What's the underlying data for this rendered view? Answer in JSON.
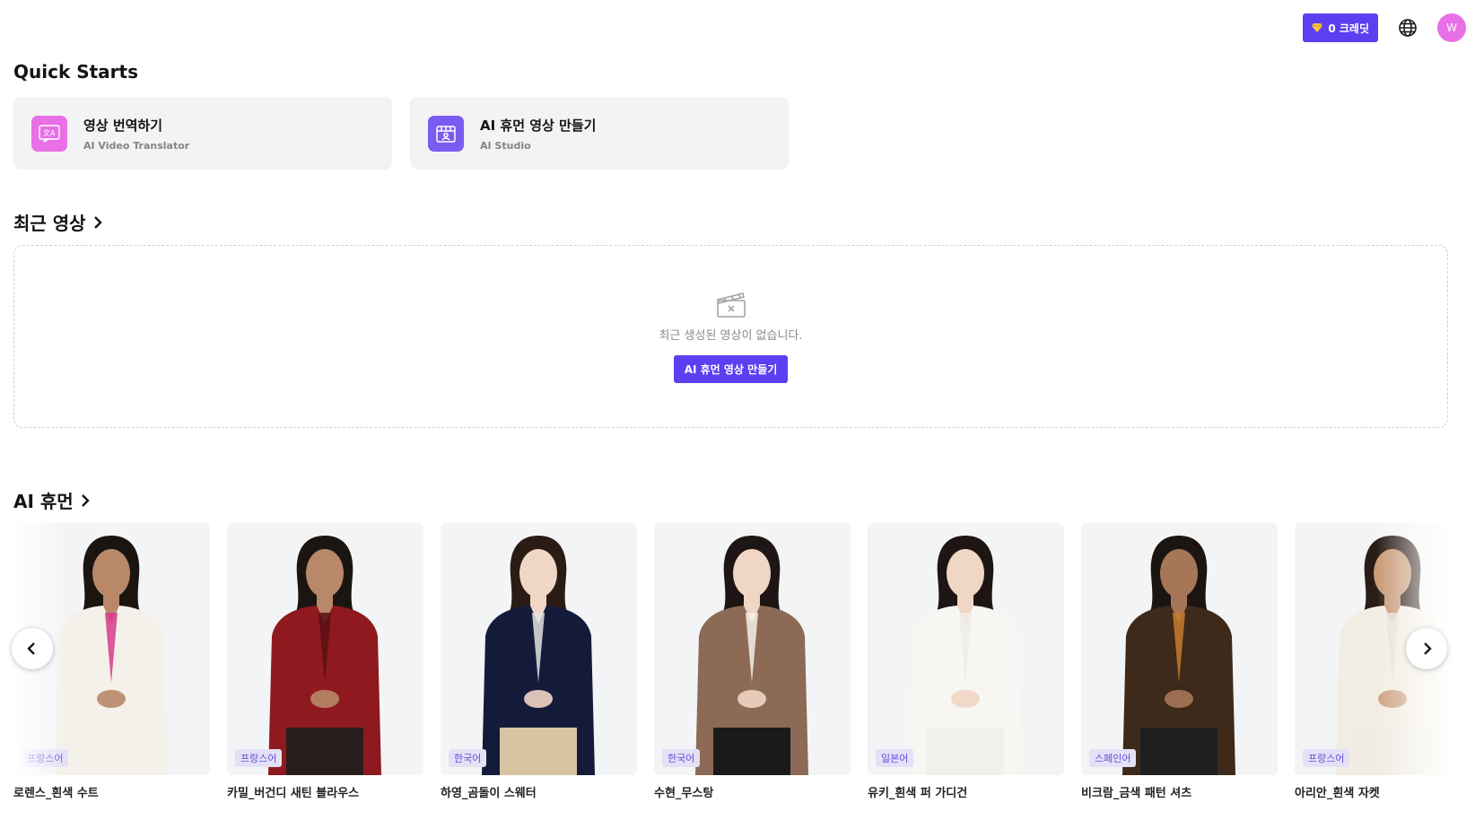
{
  "topbar": {
    "credit_label": "0 크레딧",
    "credit_icon": "gem-icon",
    "language_icon": "globe-icon",
    "avatar_initial": "W",
    "accent_color": "#5b3ff0",
    "avatar_color": "#e86fe6"
  },
  "quick_starts": {
    "title": "Quick Starts",
    "cards": [
      {
        "title": "영상 번역하기",
        "subtitle": "AI Video Translator",
        "icon": "translate-icon",
        "icon_color": "#e86fe6"
      },
      {
        "title": "AI 휴먼 영상 만들기",
        "subtitle": "AI Studio",
        "icon": "studio-icon",
        "icon_color": "#7b5cf0"
      }
    ]
  },
  "recent_videos": {
    "title": "최근 영상",
    "empty_icon": "clapperboard-icon",
    "empty_text": "최근 생성된 영상이 없습니다.",
    "cta_label": "AI 휴먼 영상 만들기"
  },
  "ai_humans": {
    "title": "AI 휴먼",
    "items": [
      {
        "name": "로렌스_흰색 수트",
        "language": "프랑스어",
        "hair": "#1b1512",
        "skin": "#b88868",
        "top": "#f4f1ea",
        "accent": "#d63c8a",
        "bottom": "#f4f1ea"
      },
      {
        "name": "카밀_버건디 새틴 블라우스",
        "language": "프랑스어",
        "hair": "#1b1512",
        "skin": "#b88868",
        "top": "#8e1a1f",
        "accent": "#5a0f12",
        "bottom": "#2a1e1c"
      },
      {
        "name": "하영_곰돌이 스웨터",
        "language": "한국어",
        "hair": "#2a1b14",
        "skin": "#f0d6c4",
        "top": "#141b3a",
        "accent": "#e3e3e3",
        "bottom": "#d8c3a3"
      },
      {
        "name": "수현_무스탕",
        "language": "한국어",
        "hair": "#1e1614",
        "skin": "#f0d6c4",
        "top": "#8c6a55",
        "accent": "#f4efe9",
        "bottom": "#1a1a1a"
      },
      {
        "name": "유키_흰색 퍼 가디건",
        "language": "일본어",
        "hair": "#1e1614",
        "skin": "#f0d6c4",
        "top": "#f7f6f3",
        "accent": "#efece6",
        "bottom": "#f2f0ec"
      },
      {
        "name": "비크람_금색 패턴 셔츠",
        "language": "스페인어",
        "hair": "#1b1512",
        "skin": "#a77659",
        "top": "#3d2a1a",
        "accent": "#c57b2c",
        "bottom": "#1f1f1f"
      },
      {
        "name": "아리안_흰색 자켓",
        "language": "프랑스어",
        "hair": "#2a1d17",
        "skin": "#c89a78",
        "top": "#f2ede2",
        "accent": "#e6dfd0",
        "bottom": "#f0ece3"
      }
    ]
  }
}
